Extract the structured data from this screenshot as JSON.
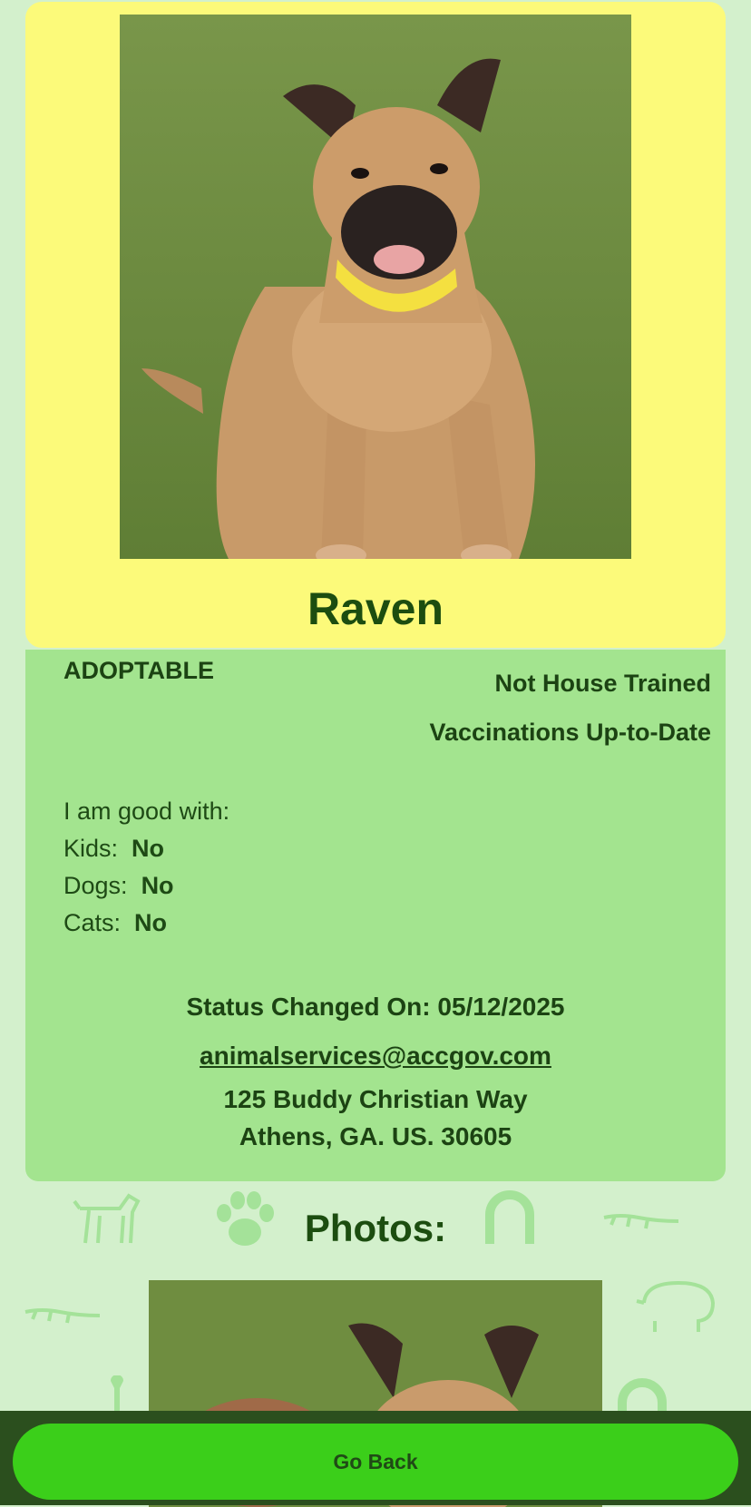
{
  "pet": {
    "name": "Raven",
    "status": "ADOPTABLE",
    "house_trained": "Not House Trained",
    "vaccinations": "Vaccinations Up-to-Date"
  },
  "good_with": {
    "heading": "I am good with:",
    "kids_label": "Kids:",
    "kids_value": "No",
    "dogs_label": "Dogs:",
    "dogs_value": "No",
    "cats_label": "Cats:",
    "cats_value": "No"
  },
  "contact": {
    "status_changed": "Status Changed On: 05/12/2025",
    "email": "animalservices@accgov.com",
    "address_line1": "125 Buddy Christian Way",
    "address_line2": "Athens,  GA.  US.  30605"
  },
  "photos": {
    "title": "Photos:"
  },
  "footer": {
    "go_back": "Go Back"
  },
  "colors": {
    "background": "#d3f0cc",
    "card_top": "#fcfa7a",
    "card_info": "#a3e48f",
    "accent_button": "#3bcf1a",
    "bottom_bar": "#2b4f1e",
    "text": "#1c4313"
  },
  "icons": [
    "paw-icon",
    "bone-icon",
    "horseshoe-icon",
    "carrot-icon",
    "dog-icon",
    "pig-icon",
    "lizard-icon",
    "rabbit-icon"
  ]
}
